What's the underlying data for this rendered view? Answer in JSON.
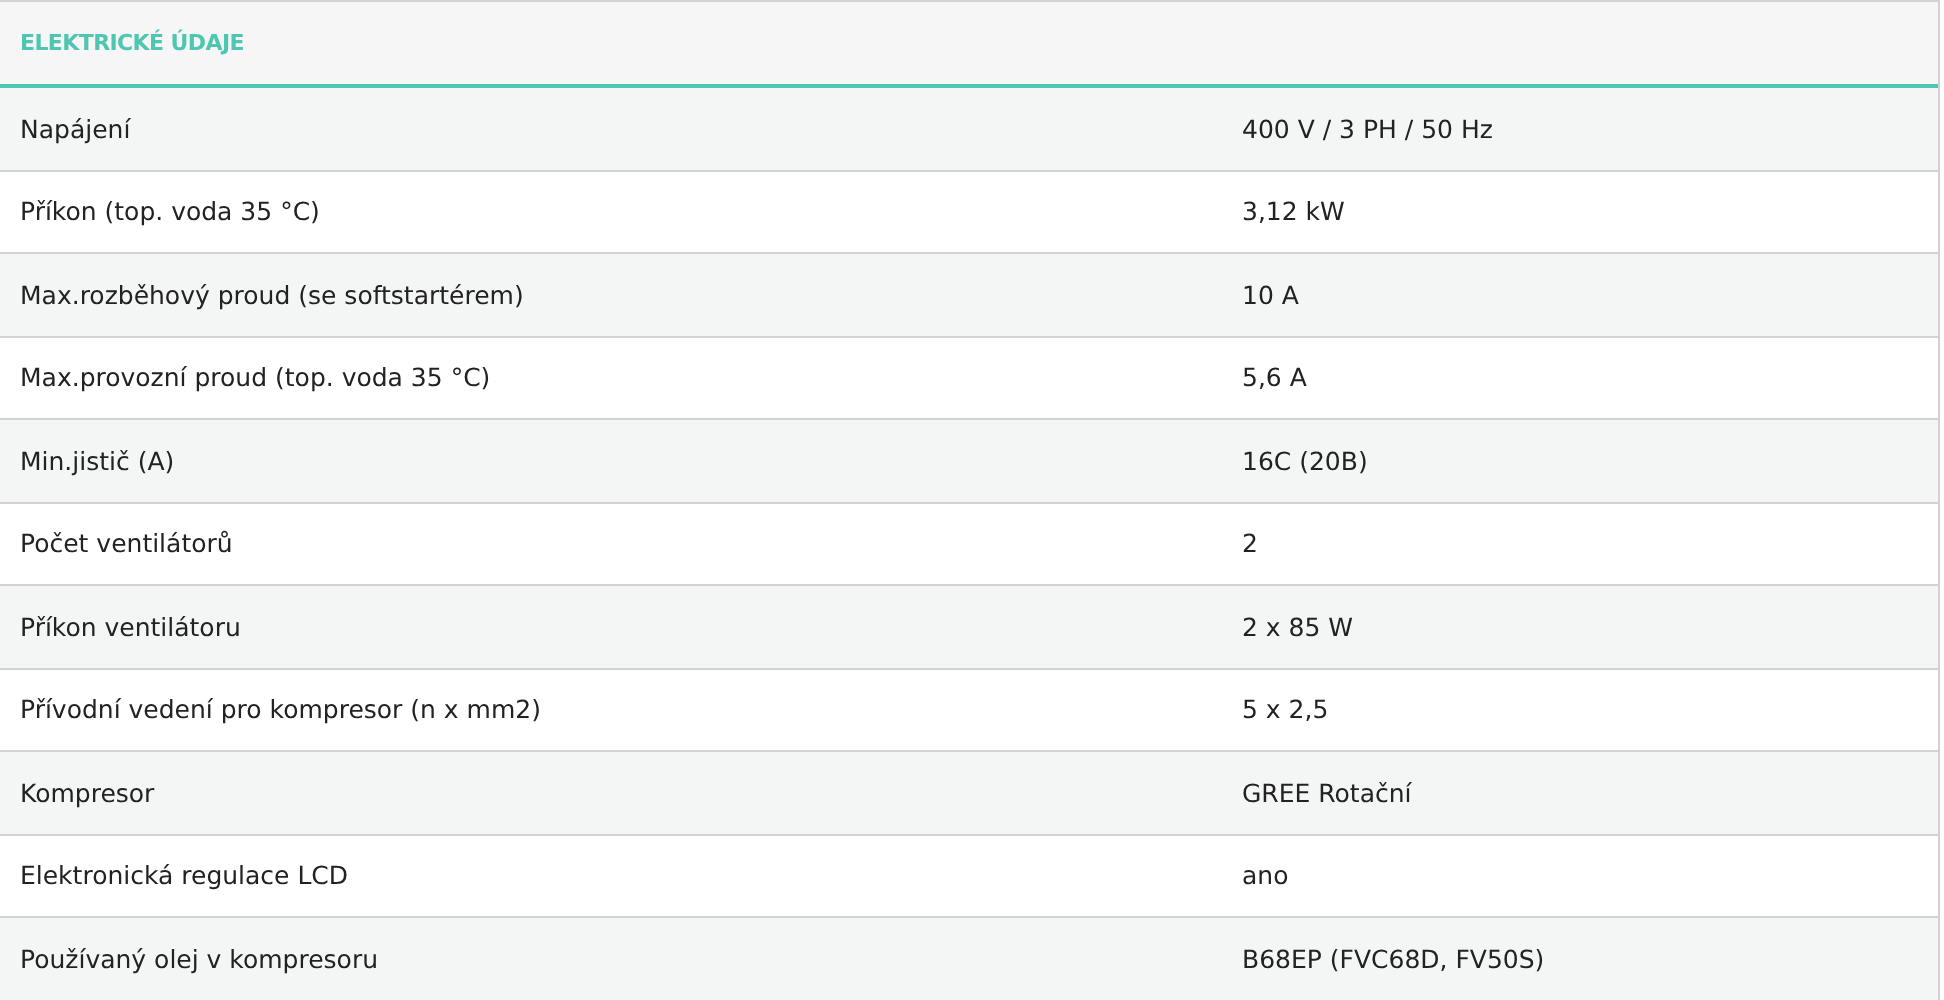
{
  "table": {
    "title": "ELEKTRICKÉ ÚDAJE",
    "rows": [
      {
        "label": "Napájení",
        "value": "400 V / 3 PH / 50 Hz"
      },
      {
        "label": "Příkon (top. voda 35 °C)",
        "value": "3,12 kW"
      },
      {
        "label": "Max.rozběhový proud (se softstartérem)",
        "value": "10 A"
      },
      {
        "label": "Max.provozní proud (top. voda 35 °C)",
        "value": "5,6 A"
      },
      {
        "label": "Min.jistič (A)",
        "value": "16C (20B)"
      },
      {
        "label": "Počet ventilátorů",
        "value": "2"
      },
      {
        "label": "Příkon ventilátoru",
        "value": "2 x 85 W"
      },
      {
        "label": "Přívodní vedení pro kompresor (n x mm2)",
        "value": "5 x 2,5"
      },
      {
        "label": "Kompresor",
        "value": "GREE Rotační"
      },
      {
        "label": "Elektronická regulace LCD",
        "value": "ano"
      },
      {
        "label": "Používaný olej v kompresoru",
        "value": "B68EP (FVC68D, FV50S)"
      }
    ]
  }
}
